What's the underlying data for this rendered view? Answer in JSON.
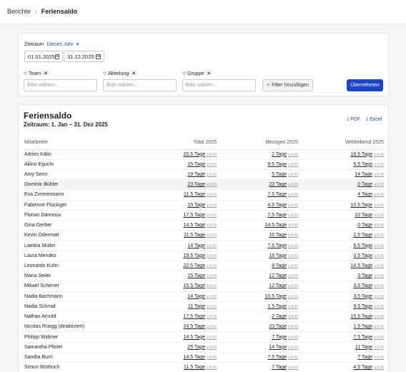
{
  "breadcrumb": {
    "parent": "Berichte",
    "separator": "›",
    "current": "Feriensaldo"
  },
  "filters": {
    "zeitraum_label": "Zeitraum",
    "zeitraum_value": "Dieses Jahr",
    "date_from": "01.01.2025",
    "date_to": "31.12.2025",
    "groups": [
      {
        "label": "Team",
        "placeholder": "Bitte wählen..."
      },
      {
        "label": "Abteilung",
        "placeholder": "Bitte wählen..."
      },
      {
        "label": "Gruppe",
        "placeholder": "Bitte wählen..."
      }
    ],
    "add_filter_label": "Filter hinzufügen",
    "apply_label": "Übernehmen"
  },
  "report": {
    "title": "Feriensaldo",
    "subtitle": "Zeitraum: 1. Jan – 31. Dez 2025",
    "pdf_label": "PDF",
    "excel_label": "Excel",
    "columns": [
      "Mitarbeiter",
      "Total 2025",
      "Bezogen 2025",
      "Verbleibend 2025"
    ],
    "unit_note": "à 8:30",
    "rows": [
      {
        "name": "Adrien Kälin",
        "total": "20.5 Tage",
        "bezogen": "2 Tage",
        "verbleibend": "18.5 Tage"
      },
      {
        "name": "Akino Eguchi",
        "total": "15 Tage",
        "bezogen": "9.5 Tage",
        "verbleibend": "5.5 Tage"
      },
      {
        "name": "Amy Senn",
        "total": "19 Tage",
        "bezogen": "5 Tage",
        "verbleibend": "14 Tage"
      },
      {
        "name": "Dominic Bühler",
        "total": "23 Tage",
        "bezogen": "23 Tage",
        "verbleibend": "0 Tage"
      },
      {
        "name": "Eva Zimmermann",
        "total": "11.5 Tage",
        "bezogen": "7.5 Tage",
        "verbleibend": "4 Tage"
      },
      {
        "name": "Fabienne Flückiger",
        "total": "15 Tage",
        "bezogen": "4.5 Tage",
        "verbleibend": "10.5 Tage"
      },
      {
        "name": "Florian Dannoux",
        "total": "17.5 Tage",
        "bezogen": "7.5 Tage",
        "verbleibend": "10 Tage"
      },
      {
        "name": "Gina Gerber",
        "total": "14.5 Tage",
        "bezogen": "14.5 Tage",
        "verbleibend": "0 Tage"
      },
      {
        "name": "Kevin Odermatt",
        "total": "11.5 Tage",
        "bezogen": "10 Tage",
        "verbleibend": "1.5 Tage"
      },
      {
        "name": "Laetitia Müller",
        "total": "14 Tage",
        "bezogen": "7.5 Tage",
        "verbleibend": "6.5 Tage"
      },
      {
        "name": "Laura Mendez",
        "total": "19.5 Tage",
        "bezogen": "19 Tage",
        "verbleibend": "0.5 Tage"
      },
      {
        "name": "Leonardo Kuhn",
        "total": "22.5 Tage",
        "bezogen": "8 Tage",
        "verbleibend": "14.5 Tage"
      },
      {
        "name": "Maria Seiler",
        "total": "15 Tage",
        "bezogen": "12 Tage",
        "verbleibend": "3 Tage"
      },
      {
        "name": "Mikael Scherrer",
        "total": "15.5 Tage",
        "bezogen": "12 Tage",
        "verbleibend": "3.5 Tage"
      },
      {
        "name": "Nadia Bachmann",
        "total": "14 Tage",
        "bezogen": "10.5 Tage",
        "verbleibend": "3.5 Tage"
      },
      {
        "name": "Nadia Schmid",
        "total": "11 Tage",
        "bezogen": "1.5 Tage",
        "verbleibend": "9.5 Tage"
      },
      {
        "name": "Nathan Arnold",
        "total": "17.5 Tage",
        "bezogen": "2 Tage",
        "verbleibend": "15.5 Tage"
      },
      {
        "name": "Nicolas Rüegg (deaktiviert)",
        "total": "24.5 Tage",
        "bezogen": "23 Tage",
        "verbleibend": "1.5 Tage"
      },
      {
        "name": "Philipp Widmer",
        "total": "14.5 Tage",
        "bezogen": "7 Tage",
        "verbleibend": "7.5 Tage"
      },
      {
        "name": "Samantha Pfister",
        "total": "25 Tage",
        "bezogen": "14 Tage",
        "verbleibend": "11 Tage"
      },
      {
        "name": "Sandra Burri",
        "total": "14.5 Tage",
        "bezogen": "7.5 Tage",
        "verbleibend": "7 Tage"
      },
      {
        "name": "Simon Wüthrich",
        "total": "11.5 Tage",
        "bezogen": "7 Tage",
        "verbleibend": "4.5 Tage"
      }
    ]
  }
}
